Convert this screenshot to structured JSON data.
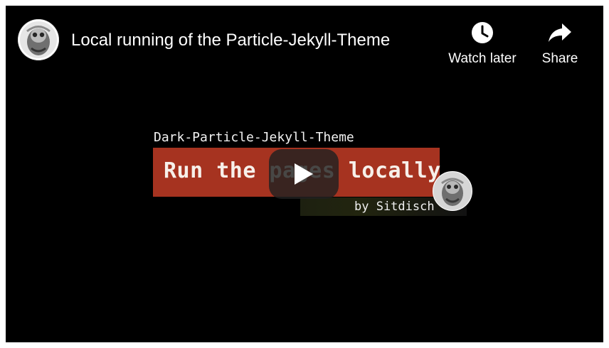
{
  "header": {
    "title": "Local running of the Particle-Jekyll-Theme",
    "avatar_icon": "channel-avatar-icon",
    "actions": [
      {
        "label": "Watch later",
        "icon": "clock-icon"
      },
      {
        "label": "Share",
        "icon": "share-arrow-icon"
      }
    ]
  },
  "thumbnail": {
    "subtitle": "Dark-Particle-Jekyll-Theme",
    "heading": "Run the pages locally",
    "byline": "by Sitdisch",
    "banner_color": "#a63320"
  },
  "player": {
    "play_icon": "play-icon",
    "background": "#000000"
  }
}
